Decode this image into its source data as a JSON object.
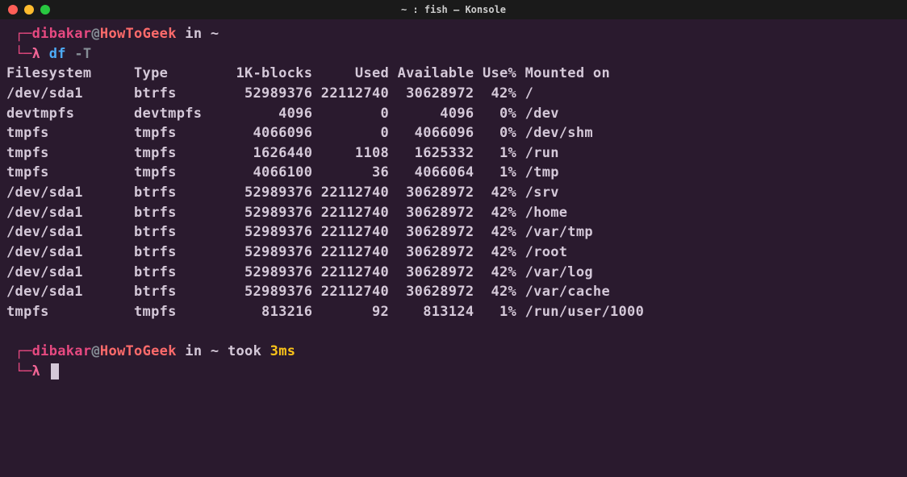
{
  "window": {
    "title": "~ : fish — Konsole"
  },
  "prompt1": {
    "bracket_top": "┌─",
    "user": "dibakar",
    "at": "@",
    "host": "HowToGeek",
    "in": " in ",
    "path": "~",
    "bracket_bottom": "└─",
    "lambda": "λ ",
    "cmd": "df",
    "flag": " -T"
  },
  "df": {
    "headers": {
      "filesystem": "Filesystem",
      "type": "Type",
      "blocks": "1K-blocks",
      "used": "Used",
      "available": "Available",
      "usepct": "Use%",
      "mounted": "Mounted on"
    },
    "rows": [
      {
        "fs": "/dev/sda1",
        "type": "btrfs",
        "blocks": "52989376",
        "used": "22112740",
        "avail": "30628972",
        "pct": "42%",
        "mount": "/"
      },
      {
        "fs": "devtmpfs",
        "type": "devtmpfs",
        "blocks": "4096",
        "used": "0",
        "avail": "4096",
        "pct": "0%",
        "mount": "/dev"
      },
      {
        "fs": "tmpfs",
        "type": "tmpfs",
        "blocks": "4066096",
        "used": "0",
        "avail": "4066096",
        "pct": "0%",
        "mount": "/dev/shm"
      },
      {
        "fs": "tmpfs",
        "type": "tmpfs",
        "blocks": "1626440",
        "used": "1108",
        "avail": "1625332",
        "pct": "1%",
        "mount": "/run"
      },
      {
        "fs": "tmpfs",
        "type": "tmpfs",
        "blocks": "4066100",
        "used": "36",
        "avail": "4066064",
        "pct": "1%",
        "mount": "/tmp"
      },
      {
        "fs": "/dev/sda1",
        "type": "btrfs",
        "blocks": "52989376",
        "used": "22112740",
        "avail": "30628972",
        "pct": "42%",
        "mount": "/srv"
      },
      {
        "fs": "/dev/sda1",
        "type": "btrfs",
        "blocks": "52989376",
        "used": "22112740",
        "avail": "30628972",
        "pct": "42%",
        "mount": "/home"
      },
      {
        "fs": "/dev/sda1",
        "type": "btrfs",
        "blocks": "52989376",
        "used": "22112740",
        "avail": "30628972",
        "pct": "42%",
        "mount": "/var/tmp"
      },
      {
        "fs": "/dev/sda1",
        "type": "btrfs",
        "blocks": "52989376",
        "used": "22112740",
        "avail": "30628972",
        "pct": "42%",
        "mount": "/root"
      },
      {
        "fs": "/dev/sda1",
        "type": "btrfs",
        "blocks": "52989376",
        "used": "22112740",
        "avail": "30628972",
        "pct": "42%",
        "mount": "/var/log"
      },
      {
        "fs": "/dev/sda1",
        "type": "btrfs",
        "blocks": "52989376",
        "used": "22112740",
        "avail": "30628972",
        "pct": "42%",
        "mount": "/var/cache"
      },
      {
        "fs": "tmpfs",
        "type": "tmpfs",
        "blocks": "813216",
        "used": "92",
        "avail": "813124",
        "pct": "1%",
        "mount": "/run/user/1000"
      }
    ]
  },
  "prompt2": {
    "bracket_top": "┌─",
    "user": "dibakar",
    "at": "@",
    "host": "HowToGeek",
    "in": " in ",
    "path": "~",
    "took": " took ",
    "duration": "3ms",
    "bracket_bottom": "└─",
    "lambda": "λ "
  }
}
